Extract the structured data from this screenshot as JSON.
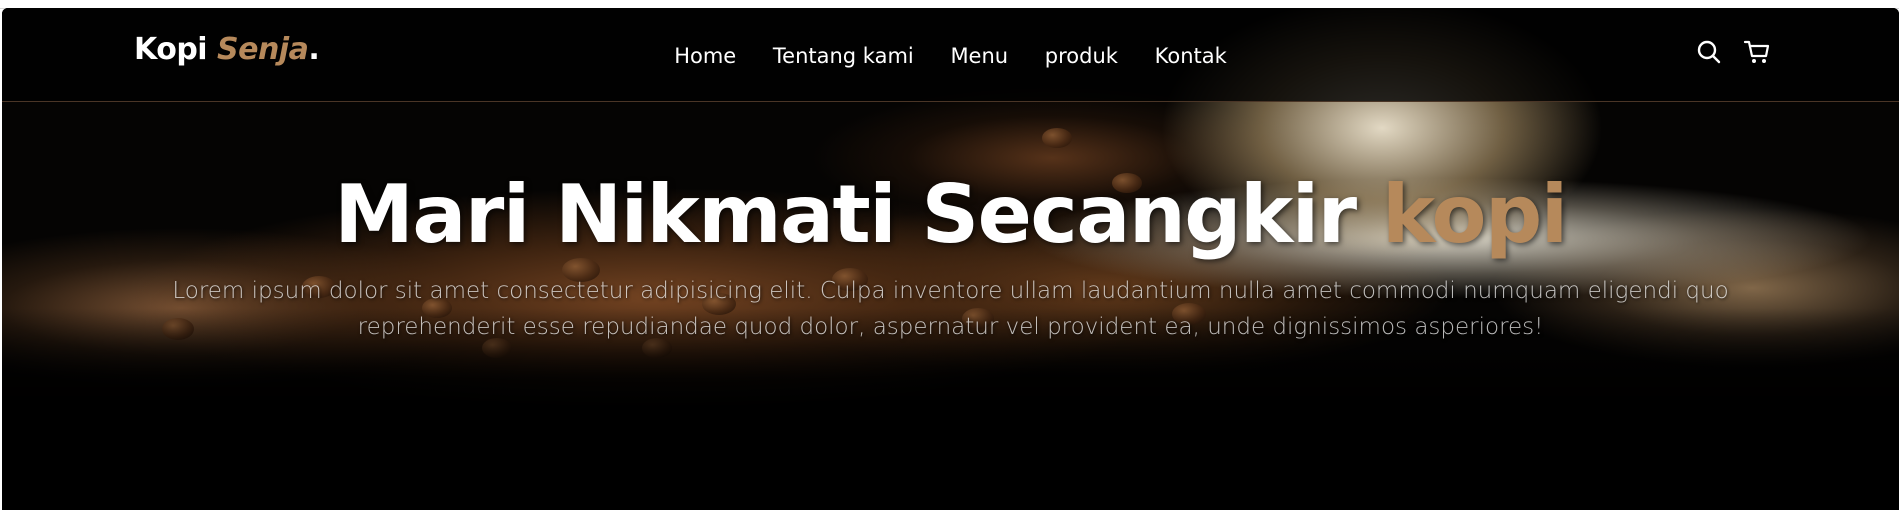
{
  "header": {
    "logo_main": "Kopi ",
    "logo_accent": "Senja",
    "logo_dot": ".",
    "nav": [
      {
        "label": "Home"
      },
      {
        "label": "Tentang kami"
      },
      {
        "label": "Menu"
      },
      {
        "label": "produk"
      },
      {
        "label": "Kontak"
      }
    ],
    "icons": [
      "search-icon",
      "shopping-cart-icon"
    ]
  },
  "hero": {
    "title_main": "Mari Nikmati Secangkir ",
    "title_accent": "kopi",
    "description": "Lorem ipsum dolor sit amet consectetur adipisicing elit. Culpa inventore ullam laudantium nulla amet commodi numquam eligendi quo reprehenderit esse repudiandae quod dolor, aspernatur vel provident ea, unde dignissimos asperiores!"
  },
  "colors": {
    "accent": "#b6895b",
    "navbar_bg": "#010101",
    "text": "#ffffff"
  }
}
